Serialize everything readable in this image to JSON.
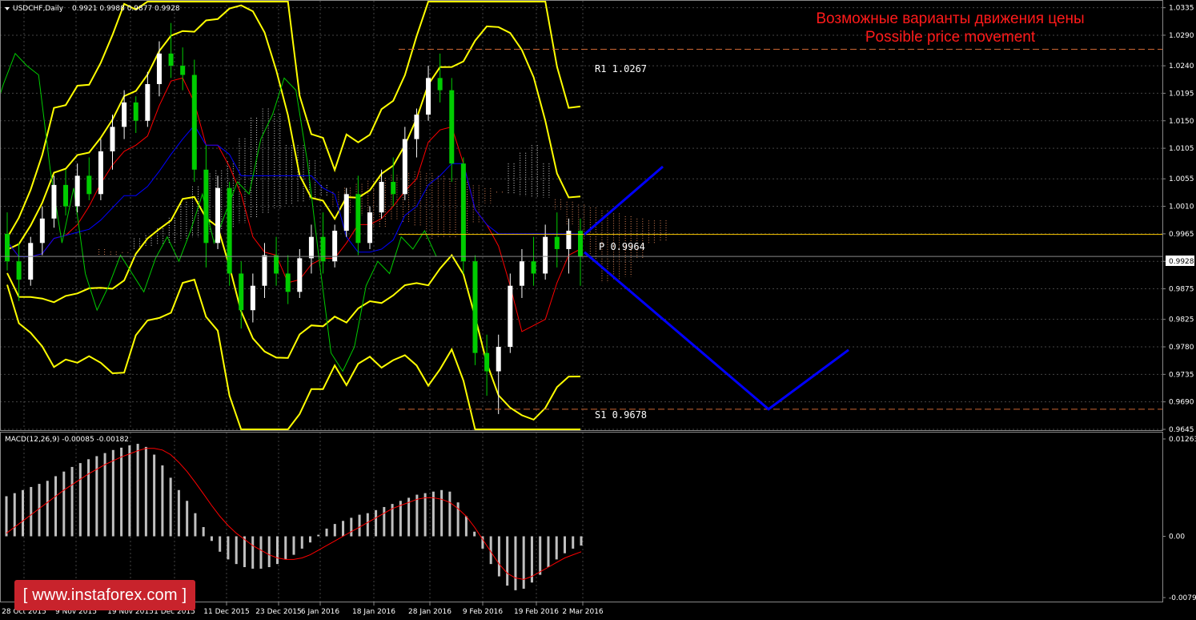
{
  "header": {
    "symbol": "USDCHF,Daily",
    "ohlc": "0.9921 0.9988 0.9877 0.9928"
  },
  "headline": {
    "ru": "Возможные варианты движения цены",
    "en": "Possible price movement"
  },
  "levels": {
    "r1": {
      "label": "R1 1.0267",
      "value": 1.0267
    },
    "pivot": {
      "label": "P 0.9964",
      "value": 0.9964
    },
    "s1": {
      "label": "S1 0.9678",
      "value": 0.9678
    }
  },
  "current_price_label": "0.9928",
  "macd_header": "MACD(12,26,9) -0.00085 -0.00182",
  "watermark": "[ www.instaforex.com ]",
  "colors": {
    "background": "#000000",
    "bull_candle": "#ffffff",
    "bear_candle": "#00cc00",
    "bollinger": "#ffff00",
    "tenkan": "#ff0000",
    "kijun": "#0000ff",
    "chikou": "#00cc00",
    "cloud_a": "#ff9966",
    "cloud_b": "#ffffff",
    "r1_s1": "#cc6633",
    "pivot": "#ffcc00",
    "forecast": "#0000ff",
    "macd_hist": "#c0c0c0",
    "macd_signal": "#ff0000",
    "headline": "#ff1a1a",
    "watermark_bg": "#c8232c"
  },
  "chart_data": [
    {
      "type": "candlestick",
      "y_ticks": [
        "1.0335",
        "1.0290",
        "1.0240",
        "1.0195",
        "1.0150",
        "1.0105",
        "1.0055",
        "1.0010",
        "0.9965",
        "0.9920",
        "0.9875",
        "0.9825",
        "0.9780",
        "0.9735",
        "0.9690",
        "0.9645"
      ],
      "ylim": [
        0.9645,
        1.0345
      ],
      "x_ticks": [
        "28 Oct 2015",
        "9 Nov 2015",
        "19 Nov 2015",
        "1 Dec 2015",
        "11 Dec 2015",
        "23 Dec 2015",
        "6 Jan 2016",
        "18 Jan 2016",
        "28 Jan 2016",
        "9 Feb 2016",
        "19 Feb 2016",
        "2 Mar 2016"
      ],
      "candles": [
        [
          0.9965,
          1.0,
          0.9905,
          0.992
        ],
        [
          0.992,
          0.995,
          0.9855,
          0.989
        ],
        [
          0.989,
          0.996,
          0.988,
          0.995
        ],
        [
          0.995,
          1.001,
          0.993,
          0.999
        ],
        [
          0.999,
          1.006,
          0.9975,
          1.0045
        ],
        [
          1.0045,
          1.007,
          0.9995,
          1.001
        ],
        [
          1.001,
          1.008,
          1.0,
          1.006
        ],
        [
          1.006,
          1.009,
          1.002,
          1.003
        ],
        [
          1.003,
          1.012,
          1.002,
          1.01
        ],
        [
          1.01,
          1.016,
          1.007,
          1.014
        ],
        [
          1.014,
          1.02,
          1.012,
          1.018
        ],
        [
          1.018,
          1.019,
          1.013,
          1.015
        ],
        [
          1.015,
          1.023,
          1.014,
          1.021
        ],
        [
          1.021,
          1.028,
          1.019,
          1.026
        ],
        [
          1.026,
          1.031,
          1.022,
          1.024
        ],
        [
          1.024,
          1.027,
          1.02,
          1.0225
        ],
        [
          1.0225,
          1.025,
          1.005,
          1.007
        ],
        [
          1.007,
          1.011,
          0.991,
          0.995
        ],
        [
          0.995,
          1.006,
          0.994,
          1.004
        ],
        [
          1.004,
          1.005,
          0.988,
          0.99
        ],
        [
          0.99,
          0.992,
          0.981,
          0.984
        ],
        [
          0.984,
          0.99,
          0.982,
          0.988
        ],
        [
          0.988,
          0.995,
          0.986,
          0.993
        ],
        [
          0.993,
          0.996,
          0.988,
          0.99
        ],
        [
          0.99,
          0.993,
          0.985,
          0.987
        ],
        [
          0.987,
          0.994,
          0.986,
          0.9925
        ],
        [
          0.9925,
          0.998,
          0.99,
          0.996
        ],
        [
          0.996,
          1.0,
          0.99,
          0.992
        ],
        [
          0.992,
          0.998,
          0.991,
          0.997
        ],
        [
          0.997,
          1.004,
          0.996,
          1.003
        ],
        [
          1.003,
          1.006,
          0.993,
          0.995
        ],
        [
          0.995,
          1.001,
          0.994,
          1.0
        ],
        [
          1.0,
          1.007,
          0.999,
          1.005
        ],
        [
          1.005,
          1.009,
          1.001,
          1.003
        ],
        [
          1.003,
          1.014,
          1.002,
          1.012
        ],
        [
          1.012,
          1.017,
          1.009,
          1.016
        ],
        [
          1.016,
          1.024,
          1.015,
          1.022
        ],
        [
          1.022,
          1.026,
          1.018,
          1.02
        ],
        [
          1.02,
          1.022,
          1.005,
          1.008
        ],
        [
          1.008,
          1.009,
          0.99,
          0.992
        ],
        [
          0.992,
          0.993,
          0.975,
          0.977
        ],
        [
          0.977,
          0.98,
          0.97,
          0.974
        ],
        [
          0.974,
          0.98,
          0.967,
          0.978
        ],
        [
          0.978,
          0.99,
          0.977,
          0.988
        ],
        [
          0.988,
          0.994,
          0.986,
          0.992
        ],
        [
          0.992,
          0.996,
          0.988,
          0.99
        ],
        [
          0.99,
          0.998,
          0.989,
          0.996
        ],
        [
          0.996,
          1.0,
          0.991,
          0.994
        ],
        [
          0.994,
          0.999,
          0.99,
          0.997
        ],
        [
          0.997,
          0.999,
          0.988,
          0.9928
        ]
      ],
      "pivot_forecast": [
        [
          0.9965
        ],
        [
          0.9678
        ],
        [
          0.9775
        ]
      ]
    },
    {
      "type": "bar",
      "title": "MACD(12,26,9)",
      "y_ticks": [
        "0.01263",
        "0.00",
        "-0.00795"
      ],
      "ylim": [
        -0.00795,
        0.01263
      ],
      "histogram": [
        0.0052,
        0.0056,
        0.006,
        0.0064,
        0.0068,
        0.0072,
        0.0078,
        0.0084,
        0.009,
        0.0095,
        0.01,
        0.0104,
        0.0108,
        0.0112,
        0.0115,
        0.0118,
        0.012,
        0.0116,
        0.0106,
        0.0092,
        0.0076,
        0.006,
        0.0046,
        0.003,
        0.0012,
        -0.0006,
        -0.002,
        -0.003,
        -0.0036,
        -0.004,
        -0.0042,
        -0.0042,
        -0.004,
        -0.0036,
        -0.003,
        -0.0024,
        -0.0016,
        -0.0008,
        0.0002,
        0.001,
        0.0016,
        0.002,
        0.0024,
        0.0028,
        0.003,
        0.0034,
        0.0038,
        0.0042,
        0.0046,
        0.005,
        0.0054,
        0.0056,
        0.0058,
        0.006,
        0.0058,
        0.0044,
        0.0026,
        0.0006,
        -0.0016,
        -0.0036,
        -0.0052,
        -0.0064,
        -0.007,
        -0.0068,
        -0.006,
        -0.005,
        -0.004,
        -0.003,
        -0.0022,
        -0.0016,
        -0.0012
      ],
      "signal": [
        0.0004,
        0.0012,
        0.002,
        0.0028,
        0.0036,
        0.0044,
        0.0052,
        0.006,
        0.0067,
        0.0074,
        0.0081,
        0.0087,
        0.0093,
        0.0098,
        0.0103,
        0.0107,
        0.0111,
        0.0114,
        0.0114,
        0.0112,
        0.0106,
        0.0096,
        0.0084,
        0.007,
        0.0055,
        0.004,
        0.0026,
        0.0014,
        0.0004,
        -0.0004,
        -0.0012,
        -0.0018,
        -0.0024,
        -0.0028,
        -0.003,
        -0.003,
        -0.0028,
        -0.0024,
        -0.0018,
        -0.0012,
        -0.0006,
        0.0,
        0.0006,
        0.0012,
        0.0018,
        0.0024,
        0.003,
        0.0036,
        0.004,
        0.0044,
        0.0048,
        0.005,
        0.005,
        0.0048,
        0.0044,
        0.0036,
        0.0026,
        0.0012,
        -0.0004,
        -0.002,
        -0.0036,
        -0.0048,
        -0.0054,
        -0.0056,
        -0.0052,
        -0.0046,
        -0.004,
        -0.0034,
        -0.0028,
        -0.0024,
        -0.002
      ]
    }
  ]
}
